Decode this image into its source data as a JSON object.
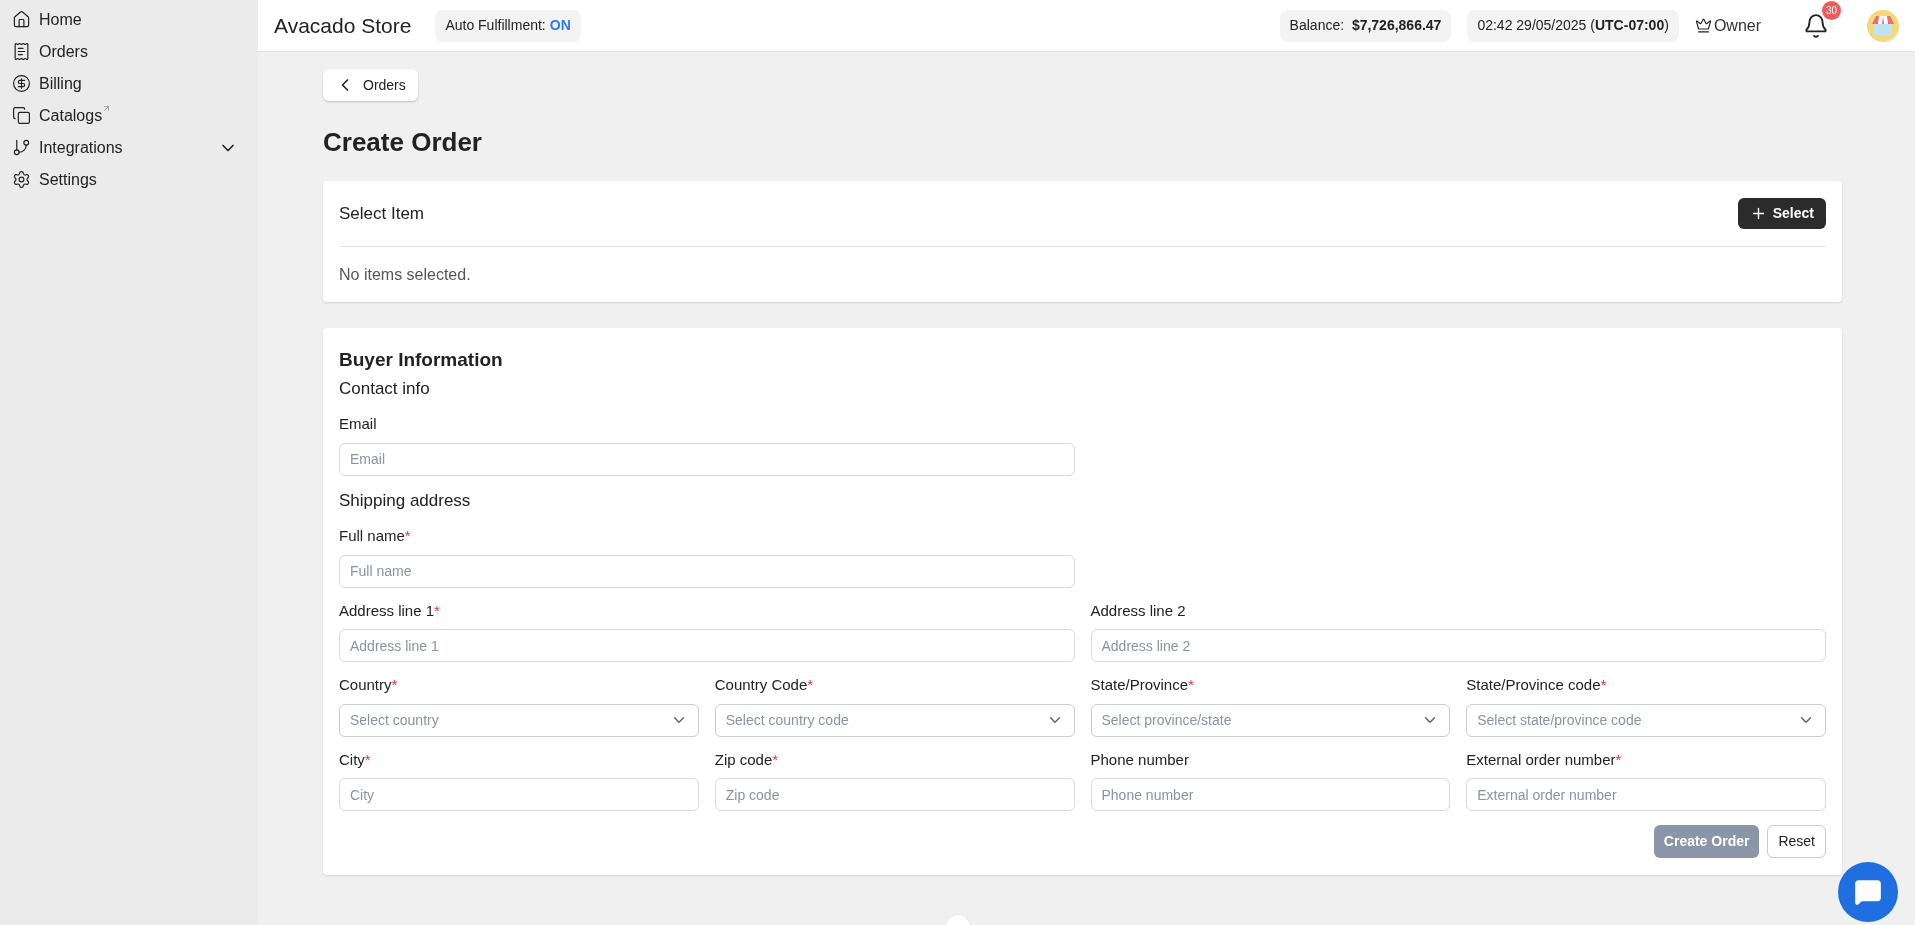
{
  "sidebar": {
    "items": [
      {
        "label": "Home",
        "selected": false
      },
      {
        "label": "Orders",
        "selected": false
      },
      {
        "label": "Billing",
        "selected": false
      },
      {
        "label": "Catalogs",
        "selected": false,
        "external": true
      },
      {
        "label": "Integrations",
        "selected": false,
        "expanded": false
      },
      {
        "label": "Settings",
        "selected": false
      }
    ]
  },
  "header": {
    "store_name": "Avacado Store",
    "auto_fulfillment": {
      "label": "Auto Fulfillment:",
      "status": "ON",
      "on": true
    },
    "balance": "Balance:  **$7,726,866.47**",
    "time": "02:42 29/05/2025 (**UTC-07:00**)",
    "role": "Owner",
    "notification_count": "30"
  },
  "back_button": "Orders",
  "page_title": "Create Order",
  "select_item": {
    "title": "Select Item",
    "button": "Select",
    "empty_text": "No items selected."
  },
  "buyer": {
    "title": "Buyer Information",
    "contact_title": "Contact info",
    "shipping_title": "Shipping address",
    "contact_rows": [
      [
        {
          "label": "Email",
          "placeholder": "Email",
          "kind": "text"
        }
      ]
    ],
    "shipping_rows": [
      [
        {
          "label": "Full name",
          "placeholder": "Full name",
          "kind": "text",
          "required_mark": "*"
        }
      ],
      [
        {
          "label": "Address line 1",
          "placeholder": "Address line 1",
          "kind": "text",
          "required_mark": "*"
        },
        {
          "label": "Address line 2",
          "placeholder": "Address line 2",
          "kind": "text"
        }
      ],
      [
        {
          "label": "Country",
          "placeholder": "Select country",
          "kind": "select",
          "required_mark": "*"
        },
        {
          "label": "Country Code",
          "placeholder": "Select country code",
          "kind": "select",
          "required_mark": "*"
        },
        {
          "label": "State/Province",
          "placeholder": "Select province/state",
          "kind": "select",
          "required_mark": "*"
        },
        {
          "label": "State/Province code",
          "placeholder": "Select state/province code",
          "kind": "select",
          "required_mark": "*"
        }
      ],
      [
        {
          "label": "City",
          "placeholder": "City",
          "kind": "text",
          "required_mark": "*"
        },
        {
          "label": "Zip code",
          "placeholder": "Zip code",
          "kind": "text",
          "required_mark": "*"
        },
        {
          "label": "Phone number",
          "placeholder": "Phone number",
          "kind": "text"
        },
        {
          "label": "External order number",
          "placeholder": "External order number",
          "kind": "text",
          "required_mark": "*"
        }
      ]
    ],
    "buttons": [
      {
        "label": "Create Order",
        "kind": "primary",
        "disabled": true
      },
      {
        "label": "Reset",
        "kind": "secondary",
        "disabled": false
      }
    ]
  }
}
